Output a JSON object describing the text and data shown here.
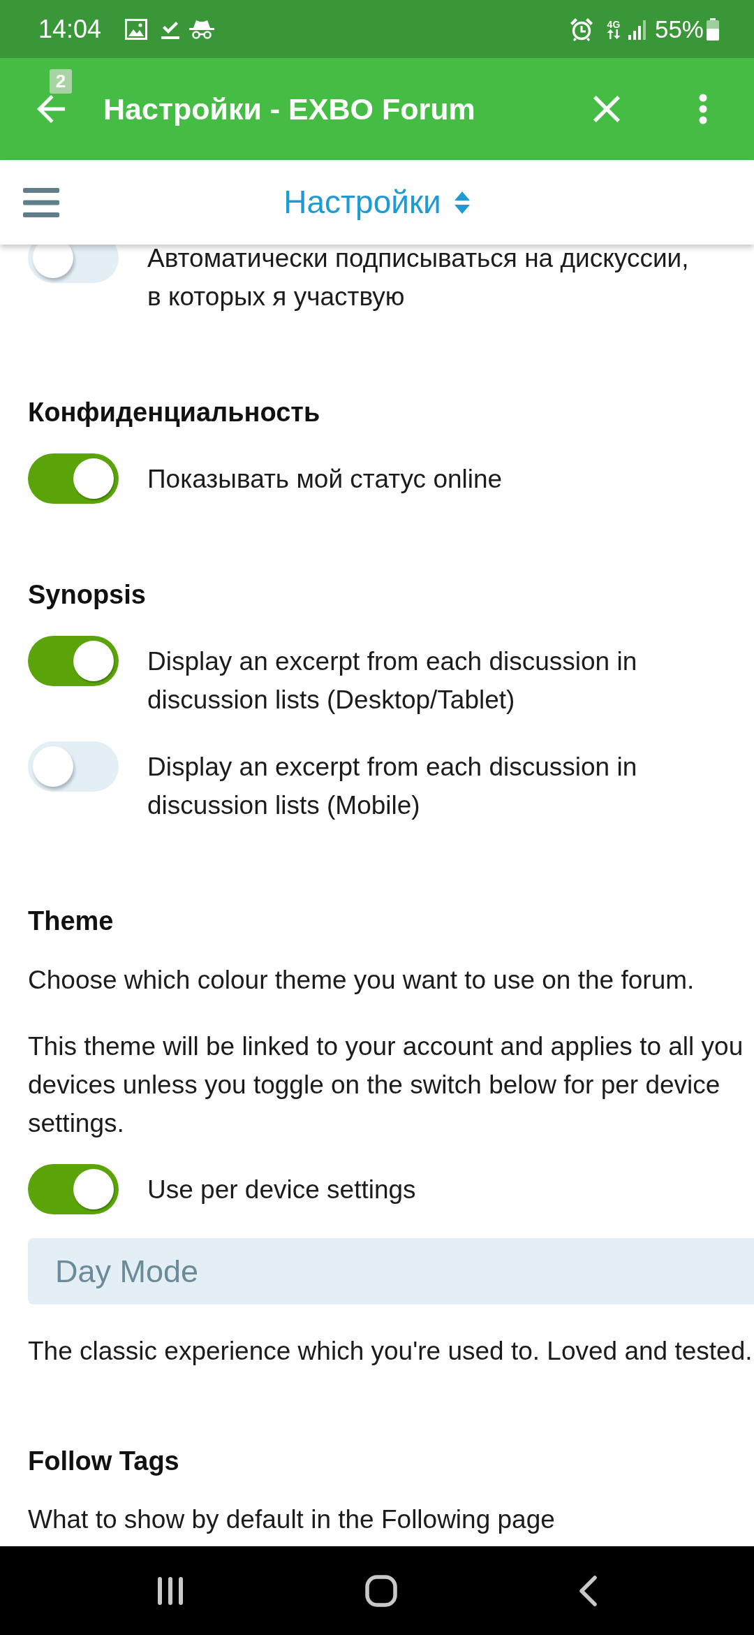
{
  "status_bar": {
    "time": "14:04",
    "network": "4G",
    "battery": "55%"
  },
  "app_bar": {
    "tab_count": "2",
    "title": "Настройки - EXBO Forum"
  },
  "page_header": {
    "title": "Настройки"
  },
  "sections": [
    {
      "items": [
        {
          "kind": "toggle",
          "label": "Автоматически подписываться на дискуссии, в которых я участвую",
          "on": false
        }
      ]
    },
    {
      "heading": "Конфиденциальность",
      "items": [
        {
          "kind": "toggle",
          "label": "Показывать мой статус online",
          "on": true
        }
      ]
    },
    {
      "heading": "Synopsis",
      "items": [
        {
          "kind": "toggle",
          "label": "Display an excerpt from each discussion in discussion lists (Desktop/Tablet)",
          "on": true
        },
        {
          "kind": "toggle",
          "label": "Display an excerpt from each discussion in discussion lists (Mobile)",
          "on": false
        }
      ]
    },
    {
      "heading": "Theme",
      "items": [
        {
          "kind": "text",
          "text": "Choose which colour theme you want to use on the forum."
        },
        {
          "kind": "text",
          "text": "This theme will be linked to your account and applies to all you devices unless you toggle on the switch below for per device settings."
        },
        {
          "kind": "toggle",
          "label": "Use per device settings",
          "on": true
        },
        {
          "kind": "select",
          "value": "Day Mode"
        },
        {
          "kind": "text",
          "text": "The classic experience which you're used to. Loved and tested."
        }
      ]
    },
    {
      "heading": "Follow Tags",
      "items": [
        {
          "kind": "text",
          "text": "What to show by default in the Following page"
        }
      ]
    }
  ]
}
